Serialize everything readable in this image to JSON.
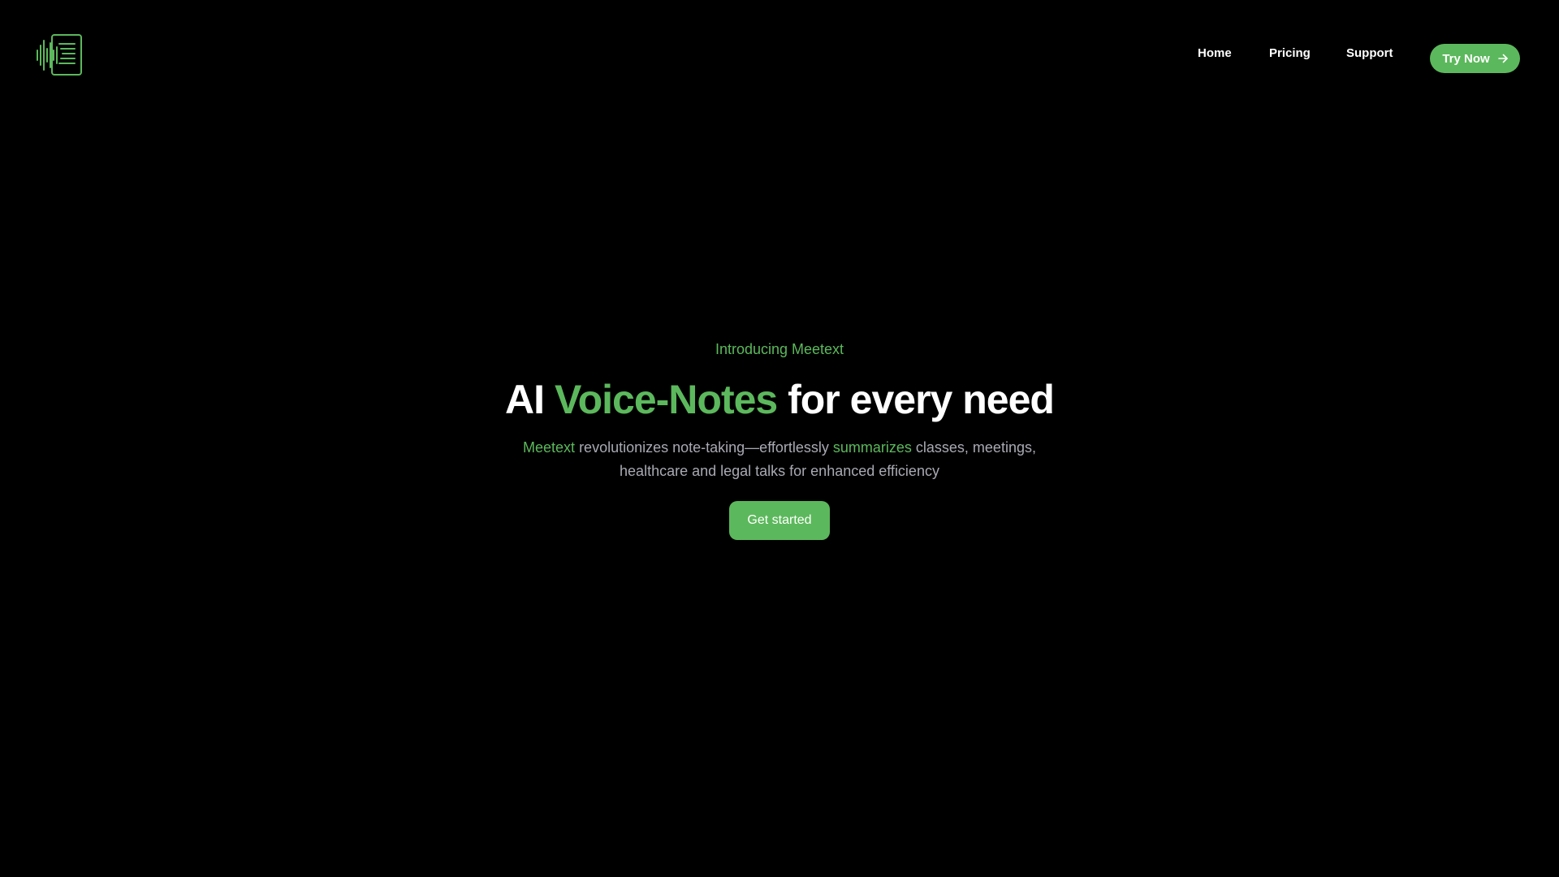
{
  "brand": {
    "logo_icon": "waveform-document-icon",
    "accent_color": "#5cb85c"
  },
  "nav": {
    "items": [
      {
        "label": "Home"
      },
      {
        "label": "Pricing"
      },
      {
        "label": "Support"
      }
    ],
    "cta_label": "Try Now",
    "cta_icon": "arrow-right-icon"
  },
  "hero": {
    "eyebrow": "Introducing Meetext",
    "headline": {
      "part1": "AI ",
      "accent": "Voice-Notes",
      "part2": " for every need"
    },
    "description": {
      "accent1": "Meetext",
      "text1": " revolutionizes note-taking—effortlessly ",
      "accent2": "summarizes",
      "text2": " classes, meetings, healthcare and legal talks for enhanced efficiency"
    },
    "cta_label": "Get started"
  }
}
